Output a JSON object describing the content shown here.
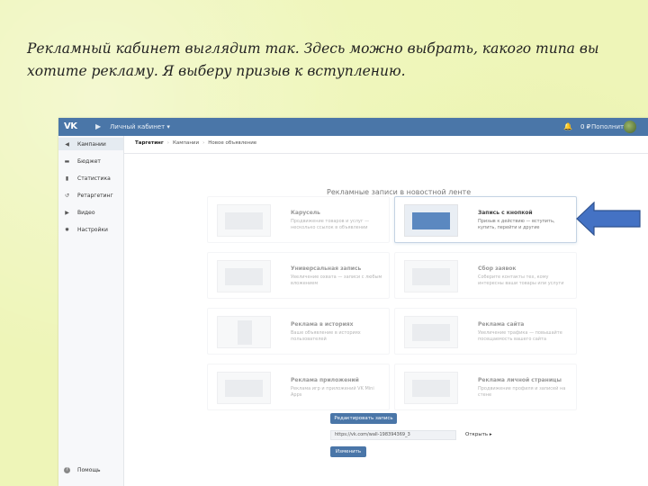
{
  "caption": "Рекламный кабинет выглядит так. Здесь можно выбрать, какого типа вы хотите рекламу. Я выберу призыв к вступлению.",
  "topbar": {
    "logo": "VK",
    "cabinet": "Личный кабинет ▾",
    "balance": "0 ₽",
    "topup": "Пополнить"
  },
  "sidebar": {
    "items": [
      {
        "label": "Кампании",
        "icon": "megaphone-icon",
        "glyph": "◀"
      },
      {
        "label": "Бюджет",
        "icon": "wallet-icon",
        "glyph": "▬"
      },
      {
        "label": "Статистика",
        "icon": "chart-icon",
        "glyph": "▮"
      },
      {
        "label": "Ретаргетинг",
        "icon": "retarget-icon",
        "glyph": "↺"
      },
      {
        "label": "Видео",
        "icon": "play-icon",
        "glyph": "▶"
      },
      {
        "label": "Настройки",
        "icon": "gear-icon",
        "glyph": "✹"
      }
    ],
    "help": "Помощь"
  },
  "breadcrumbs": [
    "Таргетинг",
    "Кампании",
    "Новое объявление"
  ],
  "section_title": "Рекламные записи в новостной ленте",
  "cards": [
    {
      "title": "Карусель",
      "desc": "Продвижение товаров и услуг — несколько ссылок в объявлении"
    },
    {
      "title": "Запись с кнопкой",
      "desc": "Призыв к действию — вступить, купить, перейти и другие"
    },
    {
      "title": "Универсальная запись",
      "desc": "Увеличение охвата — записи с любым вложением"
    },
    {
      "title": "Сбор заявок",
      "desc": "Соберите контакты тех, кому интересны ваши товары или услуги"
    },
    {
      "title": "Реклама в историях",
      "desc": "Ваше объявление в историях пользователей"
    },
    {
      "title": "Реклама сайта",
      "desc": "Увеличение трафика — повышайте посещаемость вашего сайта"
    },
    {
      "title": "Реклама приложений",
      "desc": "Реклама игр и приложений VK Mini Apps"
    },
    {
      "title": "Реклама личной страницы",
      "desc": "Продвижение профиля и записей на стене"
    }
  ],
  "edit_button": "Редактировать запись",
  "url_value": "https://vk.com/wall-198394369_3",
  "open_link": "Открыть ▸",
  "change_button": "Изменить",
  "colors": {
    "accent": "#4a76a8",
    "arrow": "#4472c4",
    "background": "#eef5b8"
  }
}
